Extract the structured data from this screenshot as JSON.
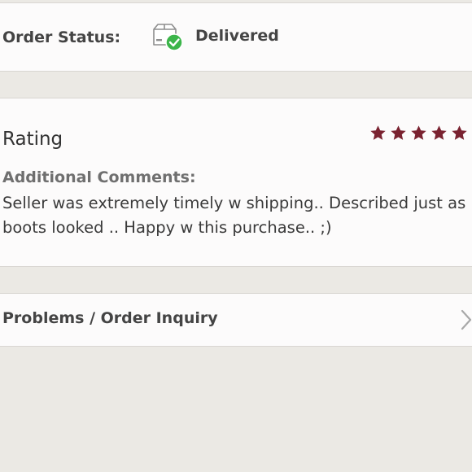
{
  "order_status": {
    "label": "Order Status:",
    "value": "Delivered",
    "icon": "package-delivered-icon",
    "check_color": "#3cb54a"
  },
  "rating": {
    "title": "Rating",
    "stars": 5,
    "max_stars": 5,
    "star_color": "#7a2230",
    "comments_label": "Additional Comments:",
    "comments_text": "Seller was extremely timely w shipping.. Described just as boots looked .. Happy w this purchase.. ;)"
  },
  "inquiry": {
    "label": "Problems / Order Inquiry",
    "icon": "chevron-right-icon"
  }
}
